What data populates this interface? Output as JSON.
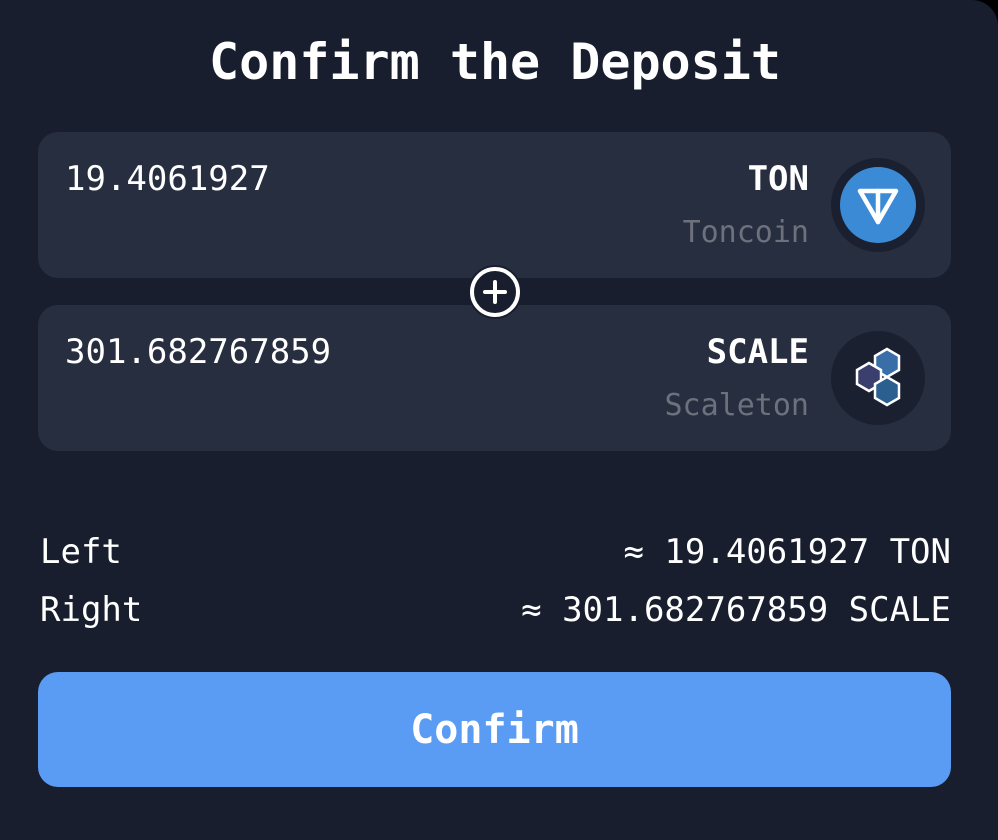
{
  "modal": {
    "title": "Confirm the Deposit"
  },
  "tokens": [
    {
      "amount": "19.4061927",
      "symbol": "TON",
      "name": "Toncoin",
      "icon": "ton-icon",
      "color": "#3b8ad6"
    },
    {
      "amount": "301.682767859",
      "symbol": "SCALE",
      "name": "Scaleton",
      "icon": "scaleton-icon",
      "color": "#2a5f8f"
    }
  ],
  "separator_icon": "plus-circle-icon",
  "summary": {
    "left_label": "Left",
    "left_value": "≈ 19.4061927 TON",
    "right_label": "Right",
    "right_value": "≈ 301.682767859 SCALE"
  },
  "confirm_label": "Confirm",
  "colors": {
    "background": "#181e2e",
    "card": "#272e40",
    "accent": "#5a9bf4",
    "muted_text": "#6c717c"
  }
}
